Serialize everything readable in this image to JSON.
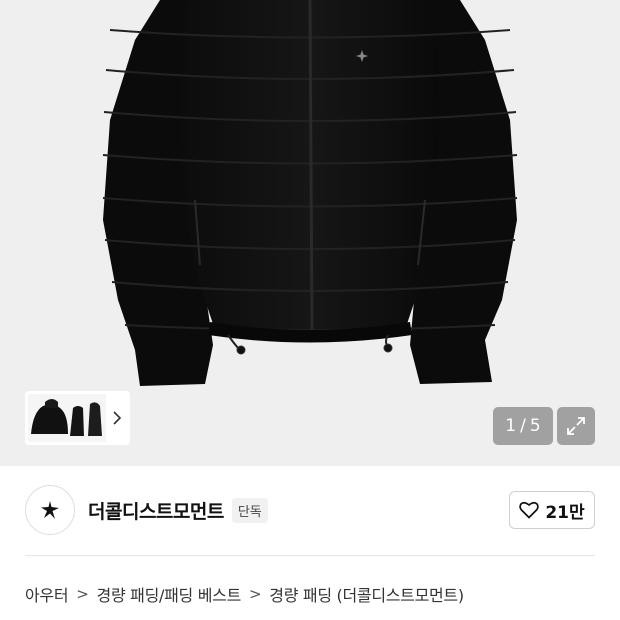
{
  "gallery": {
    "image_subject": "black-padded-jacket",
    "counter_current": "1",
    "counter_separator": "/",
    "counter_total": "5",
    "thumbnail_chevron": "chevron-right-icon",
    "expand_icon": "expand-icon"
  },
  "brand": {
    "name": "더콜디스트모먼트",
    "badge": "단독",
    "logo_icon": "star-logo-icon"
  },
  "like": {
    "icon": "heart-icon",
    "count": "21만"
  },
  "breadcrumb": {
    "items": [
      "아우터",
      "경량 패딩/패딩 베스트",
      "경량 패딩 (더콜디스트모먼트)"
    ],
    "separator": ">"
  },
  "colors": {
    "gallery_bg": "#efefef",
    "overlay": "#828282",
    "text": "#111111",
    "badge_bg": "#f1f1f1"
  }
}
